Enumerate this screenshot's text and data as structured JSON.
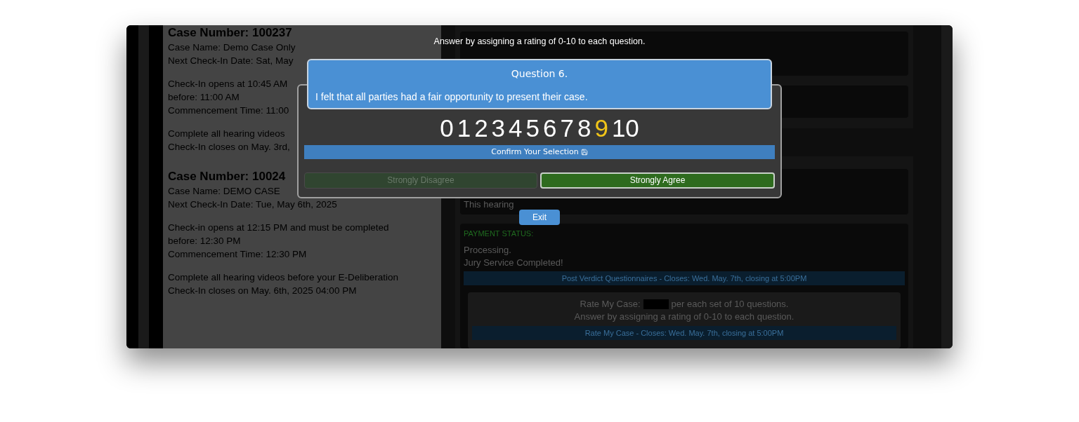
{
  "prompt": "Answer by assigning a rating of 0-10 to each question.",
  "question": {
    "title": "Question 6.",
    "text": "I felt that all parties had a fair opportunity to present their case."
  },
  "ratings": [
    {
      "label": "0",
      "selected": false
    },
    {
      "label": "1",
      "selected": false
    },
    {
      "label": "2",
      "selected": false
    },
    {
      "label": "3",
      "selected": false
    },
    {
      "label": "4",
      "selected": false
    },
    {
      "label": "5",
      "selected": false
    },
    {
      "label": "6",
      "selected": false
    },
    {
      "label": "7",
      "selected": false
    },
    {
      "label": "8",
      "selected": false
    },
    {
      "label": "9",
      "selected": true
    },
    {
      "label": "10",
      "selected": false
    }
  ],
  "confirm_button": "Confirm Your Selection",
  "scale_buttons": [
    {
      "label": "Strongly Disagree",
      "selected": false
    },
    {
      "label": "Strongly Agree",
      "selected": true
    }
  ],
  "exit_button": "Exit",
  "cases": [
    {
      "title": "Case Number: 100237",
      "groups": [
        [
          "Case Name: Demo Case Only",
          "Next Check-In Date: Sat, May"
        ],
        [
          "Check-In opens at 10:45 AM",
          "before: 11:00 AM",
          "Commencement Time: 11:00"
        ],
        [
          "Complete all hearing videos",
          "Check-In closes on May. 3rd,"
        ]
      ]
    },
    {
      "title": "Case Number: 10024",
      "groups": [
        [
          "Case Name: DEMO CASE",
          "Next Check-In Date: Tue, May 6th, 2025"
        ],
        [
          "Check-in opens at 12:15 PM and must be completed",
          "before: 12:30 PM",
          "Commencement Time: 12:30 PM"
        ],
        [
          "Complete all hearing videos before your E-Deliberation",
          "Check-In closes on May. 6th, 2025 04:00 PM"
        ]
      ]
    }
  ],
  "hearing_note": "This hearing",
  "payment": {
    "heading": "PAYMENT STATUS:",
    "lines": [
      "Processing.",
      "Jury Service Completed!"
    ],
    "questionnaire_bar": "Post Verdict Questionnaires - Closes: Wed. May. 7th, closing at 5:00PM"
  },
  "rate_card": {
    "label": "Rate My Case:",
    "rest": "per each set of 10 questions.",
    "instruction": "Answer by assigning a rating of 0-10 to each question.",
    "bar": "Rate My Case - Closes: Wed. May. 7th, closing at 5:00PM"
  }
}
